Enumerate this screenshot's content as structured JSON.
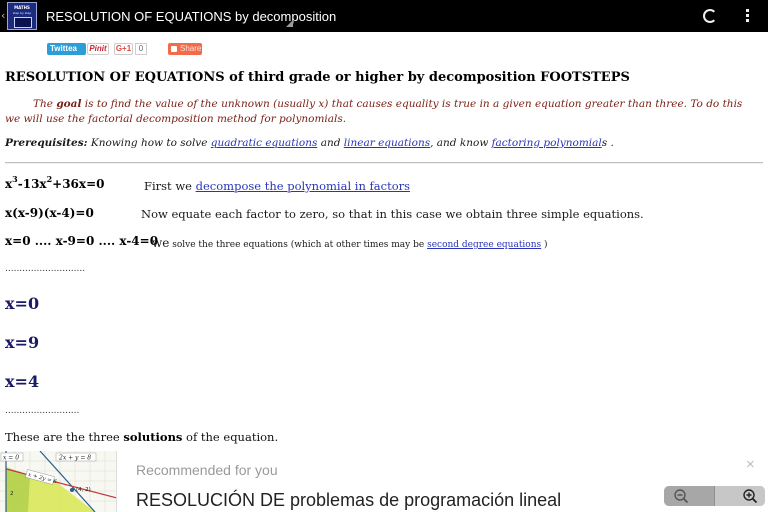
{
  "app": {
    "title": "RESOLUTION OF EQUATIONS by decomposition",
    "logo_line1": "MATHS",
    "logo_line2": "step by step",
    "back_glyph": "‹"
  },
  "share": {
    "twitter": "Twittea",
    "pinit": "Pinit",
    "gplus": "G+1",
    "gplus_count": "0",
    "share": "Share"
  },
  "page": {
    "heading": "RESOLUTION OF EQUATIONS of third grade or higher by decomposition FOOTSTEPS",
    "goal": {
      "pre": "The ",
      "bold": "goal",
      "rest": " is to find the value of the unknown (usually x) that causes equality is true in a given equation greater than three. To do this we will use the factorial decomposition method for polynomials."
    },
    "prereq": {
      "label": "Prerequisites:",
      "text1": " Knowing how to solve ",
      "link1": "quadratic equations",
      "text2": " and ",
      "link2": "linear equations",
      "text3": ", and know ",
      "link3": "factoring polynomial",
      "text4": "s ."
    },
    "steps": [
      {
        "eq_pre": "x",
        "eq_sup1": "3",
        "eq_mid": "-13x",
        "eq_sup2": "2",
        "eq_post": "+36x=0",
        "note_pre": "First we ",
        "note_link": "decompose the polynomial in factors"
      },
      {
        "eq": "x(x-9)(x-4)=0",
        "note": "Now equate each factor to zero, so that in this case we obtain three simple equations."
      },
      {
        "eq": "x=0 .... x-9=0 .... x-4=0",
        "note_we": "we",
        "note_text": " solve the three equations (which at other times may be ",
        "note_link": "second degree equations",
        "note_end": " )"
      }
    ],
    "dots1": "............................",
    "solutions": [
      "x=0",
      "x=9",
      "x=4"
    ],
    "dots2": "..........................",
    "final_pre": "These are the three ",
    "final_bold": "solutions",
    "final_post": " of the equation."
  },
  "recommended": {
    "label": "Recommended for you",
    "title": "RESOLUCIÓN DE problemas de programación lineal",
    "close": "×",
    "thumb": {
      "eq1": "x = 0",
      "eq2": "2x + y = 8",
      "eq3": "x + 2y = 6",
      "eq4": "(4, 2)",
      "ytick": "2"
    }
  },
  "colors": {
    "appbar": "#000000",
    "heading": "#000000",
    "goal_text": "#7a1e13",
    "link": "#2a34b8",
    "solution": "#1a1a66",
    "twitter": "#2b9ed8",
    "share": "#f26b4a"
  },
  "icons": [
    "back-icon",
    "app-logo",
    "loading-icon",
    "overflow-menu-icon",
    "zoom-out-icon",
    "zoom-in-icon",
    "close-icon"
  ]
}
